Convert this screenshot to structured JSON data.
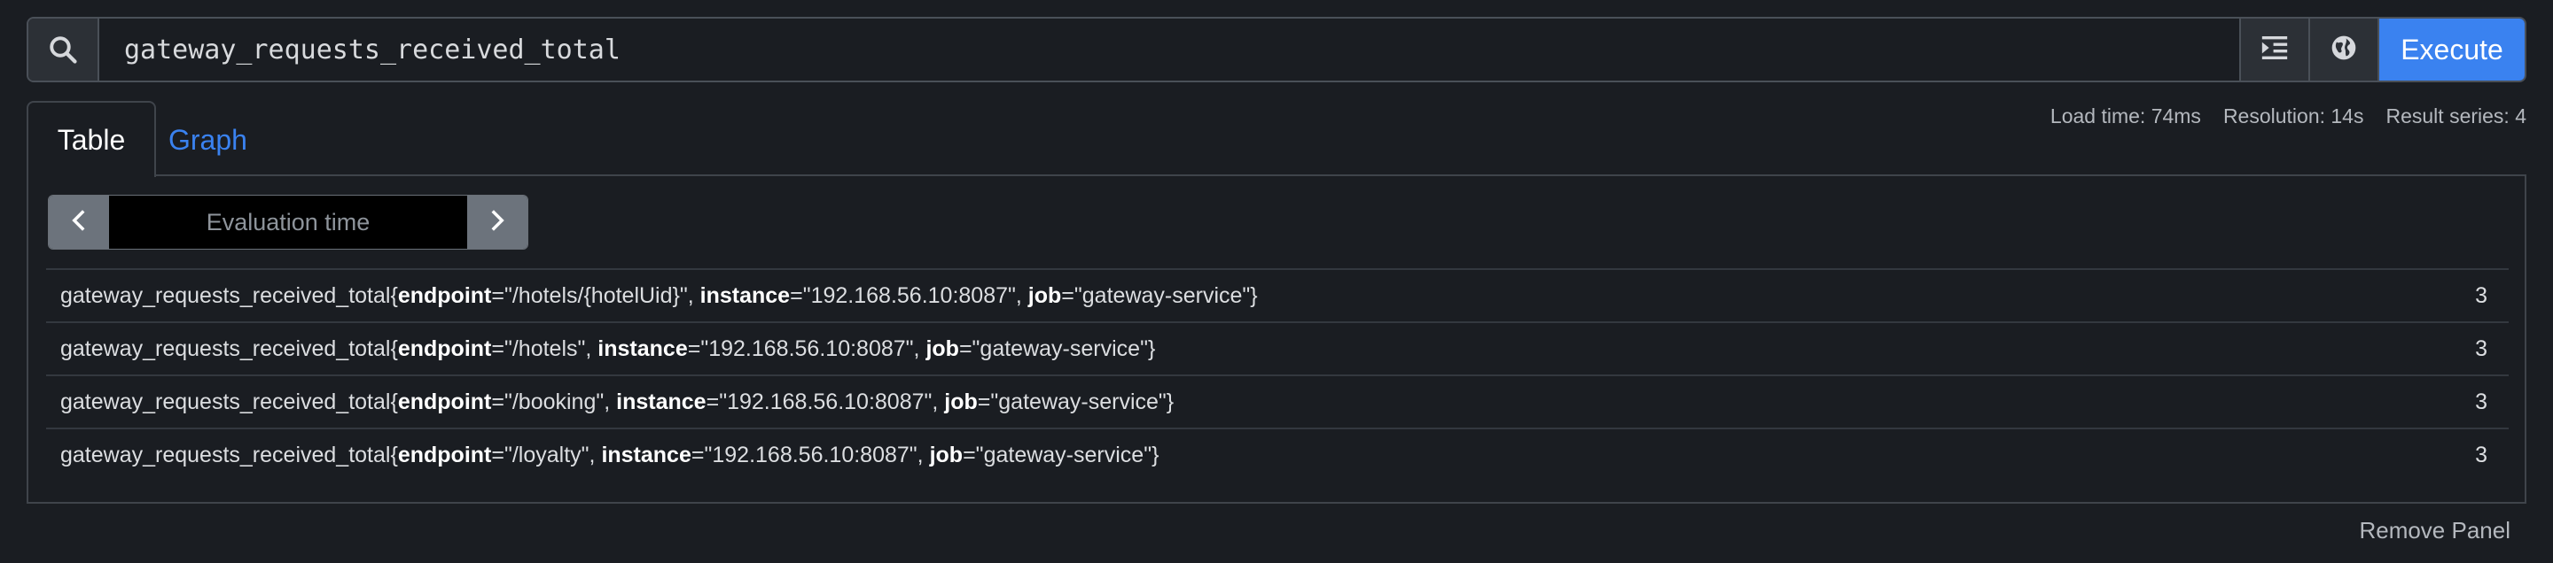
{
  "query": {
    "value": "gateway_requests_received_total",
    "execute_label": "Execute",
    "icons": [
      "search-icon",
      "format-icon",
      "globe-icon"
    ]
  },
  "tabs": [
    {
      "label": "Table",
      "active": true
    },
    {
      "label": "Graph",
      "active": false
    }
  ],
  "stats": {
    "load_time": "Load time: 74ms",
    "resolution": "Resolution: 14s",
    "result_series": "Result series: 4"
  },
  "evaluation": {
    "placeholder": "Evaluation time"
  },
  "results": [
    {
      "metric": "gateway_requests_received_total",
      "labels": [
        [
          "endpoint",
          "/hotels/{hotelUid}"
        ],
        [
          "instance",
          "192.168.56.10:8087"
        ],
        [
          "job",
          "gateway-service"
        ]
      ],
      "value": "3"
    },
    {
      "metric": "gateway_requests_received_total",
      "labels": [
        [
          "endpoint",
          "/hotels"
        ],
        [
          "instance",
          "192.168.56.10:8087"
        ],
        [
          "job",
          "gateway-service"
        ]
      ],
      "value": "3"
    },
    {
      "metric": "gateway_requests_received_total",
      "labels": [
        [
          "endpoint",
          "/booking"
        ],
        [
          "instance",
          "192.168.56.10:8087"
        ],
        [
          "job",
          "gateway-service"
        ]
      ],
      "value": "3"
    },
    {
      "metric": "gateway_requests_received_total",
      "labels": [
        [
          "endpoint",
          "/loyalty"
        ],
        [
          "instance",
          "192.168.56.10:8087"
        ],
        [
          "job",
          "gateway-service"
        ]
      ],
      "value": "3"
    }
  ],
  "remove_panel_label": "Remove Panel",
  "colors": {
    "accent": "#3a82f0",
    "background": "#1a1d22"
  }
}
